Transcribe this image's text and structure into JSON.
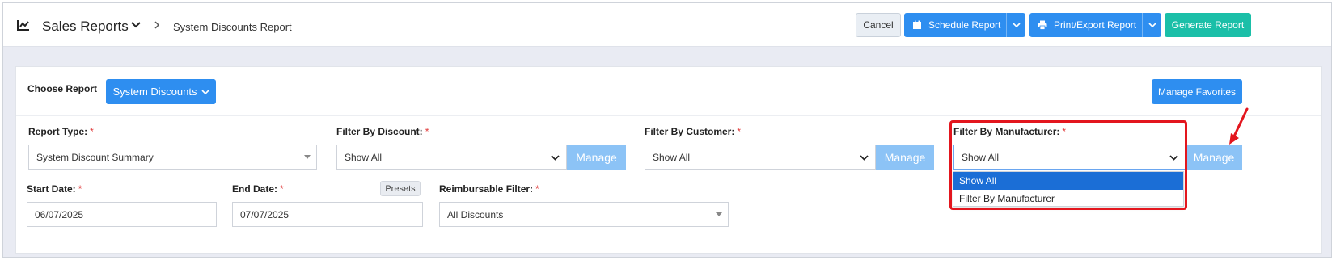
{
  "header": {
    "title": "Sales Reports",
    "breadcrumb_current": "System Discounts Report",
    "cancel_label": "Cancel",
    "schedule_label": "Schedule Report",
    "print_label": "Print/Export Report",
    "generate_label": "Generate Report"
  },
  "choose": {
    "label": "Choose Report",
    "selected": "System Discounts",
    "manage_favorites_label": "Manage Favorites"
  },
  "filters": {
    "report_type": {
      "label": "Report Type:",
      "value": "System Discount Summary"
    },
    "discount": {
      "label": "Filter By Discount:",
      "value": "Show All",
      "manage_label": "Manage"
    },
    "customer": {
      "label": "Filter By Customer:",
      "value": "Show All",
      "manage_label": "Manage"
    },
    "manufacturer": {
      "label": "Filter By Manufacturer:",
      "value": "Show All",
      "manage_label": "Manage",
      "options": [
        "Show All",
        "Filter By Manufacturer"
      ]
    },
    "start_date": {
      "label": "Start Date:",
      "value": "06/07/2025"
    },
    "end_date": {
      "label": "End Date:",
      "value": "07/07/2025",
      "presets_label": "Presets"
    },
    "reimbursable": {
      "label": "Reimbursable Filter:",
      "value": "All Discounts"
    },
    "required_mark": "*"
  },
  "colors": {
    "primary": "#2e8ef0",
    "teal": "#1bbfa8",
    "manage_disabled": "#8cc3f6",
    "highlight": "#e3161e",
    "selected_option": "#1b6ed6"
  }
}
